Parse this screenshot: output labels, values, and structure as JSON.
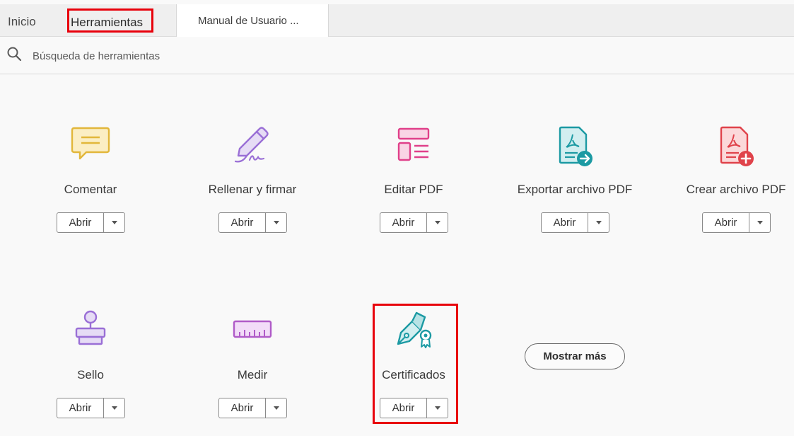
{
  "tabs": {
    "home": "Inicio",
    "tools": "Herramientas",
    "document": "Manual de Usuario ..."
  },
  "search": {
    "placeholder": "Búsqueda de herramientas"
  },
  "tools": [
    {
      "name": "Comentar",
      "open": "Abrir",
      "icon": "comment-icon",
      "color": "#e2b73b"
    },
    {
      "name": "Rellenar y firmar",
      "open": "Abrir",
      "icon": "fill-sign-icon",
      "color": "#9a6fd6"
    },
    {
      "name": "Editar PDF",
      "open": "Abrir",
      "icon": "edit-pdf-icon",
      "color": "#e0408a"
    },
    {
      "name": "Exportar archivo PDF",
      "open": "Abrir",
      "icon": "export-pdf-icon",
      "color": "#1c9aa3"
    },
    {
      "name": "Crear archivo PDF",
      "open": "Abrir",
      "icon": "create-pdf-icon",
      "color": "#e0434b"
    },
    {
      "name": "Sello",
      "open": "Abrir",
      "icon": "stamp-icon",
      "color": "#9a6fd6"
    },
    {
      "name": "Medir",
      "open": "Abrir",
      "icon": "ruler-icon",
      "color": "#b05bc8"
    },
    {
      "name": "Certificados",
      "open": "Abrir",
      "icon": "certificate-pen-icon",
      "color": "#1c9aa3"
    }
  ],
  "more_button": "Mostrar más",
  "colors": {
    "highlight": "#e8000b"
  }
}
